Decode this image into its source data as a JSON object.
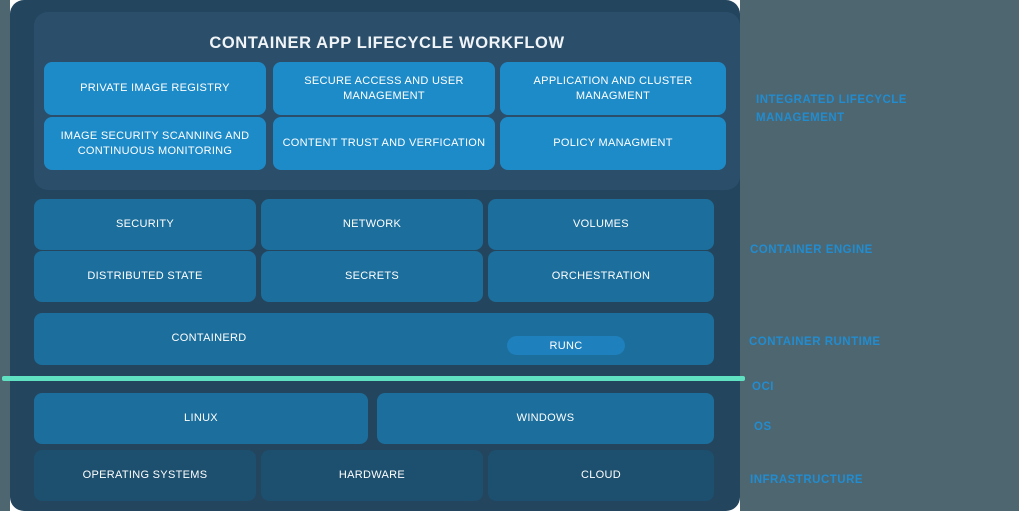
{
  "diagram": {
    "title": "CONTAINER APP LIFECYCLE WORKFLOW",
    "colors": {
      "panel_background": "#24455e",
      "card_background": "#2b4f6b",
      "slate_band": "#4d6670",
      "box_bright_blue": "#1e8bc9",
      "box_mid_blue": "#1c6e9c",
      "box_dark_blue": "#1d4f6e",
      "runc_pill": "#1e80bd",
      "oci_divider_teal": "#60e2c2",
      "side_label_blue": "#1f8fd6"
    }
  },
  "lifecycle_boxes": [
    {
      "label": "PRIVATE IMAGE REGISTRY"
    },
    {
      "label": "SECURE ACCESS AND USER MANAGEMENT"
    },
    {
      "label": "APPLICATION AND CLUSTER MANAGMENT"
    },
    {
      "label": "IMAGE SECURITY SCANNING AND CONTINUOUS MONITORING"
    },
    {
      "label": "CONTENT TRUST AND VERFICATION"
    },
    {
      "label": "POLICY MANAGMENT"
    }
  ],
  "engine_boxes": [
    {
      "label": "SECURITY"
    },
    {
      "label": "NETWORK"
    },
    {
      "label": "VOLUMES"
    },
    {
      "label": "DISTRIBUTED STATE"
    },
    {
      "label": "SECRETS"
    },
    {
      "label": "ORCHESTRATION"
    }
  ],
  "runtime": {
    "containerd_label": "CONTAINERD",
    "runc_label": "RUNC"
  },
  "os_boxes": [
    {
      "label": "LINUX"
    },
    {
      "label": "WINDOWS"
    }
  ],
  "infrastructure_boxes": [
    {
      "label": "OPERATING SYSTEMS"
    },
    {
      "label": "HARDWARE"
    },
    {
      "label": "CLOUD"
    }
  ],
  "side_labels": [
    {
      "label": "INTEGRATED LIFECYCLE MANAGEMENT"
    },
    {
      "label": "CONTAINER ENGINE"
    },
    {
      "label": "CONTAINER RUNTIME"
    },
    {
      "label": "OCI"
    },
    {
      "label": "OS"
    },
    {
      "label": "INFRASTRUCTURE"
    }
  ]
}
